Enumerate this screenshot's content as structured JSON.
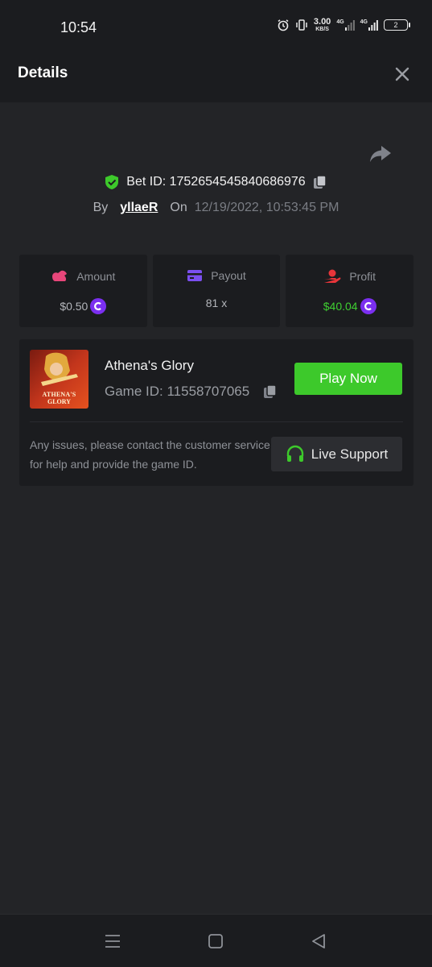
{
  "status_bar": {
    "time": "10:54",
    "network_speed": "3.00",
    "network_speed_unit": "KB/S",
    "network_1": "4G",
    "network_2": "4G",
    "battery": "2",
    "icons": [
      "alarm-icon",
      "vibrate-icon",
      "signal-icon",
      "signal-icon",
      "battery-icon"
    ]
  },
  "header": {
    "title": "Details",
    "close_icon": "close-icon"
  },
  "bet": {
    "share_icon": "share-icon",
    "verified_icon": "shield-check-icon",
    "bet_id_text": "Bet ID: 1752654545840686976",
    "copy_icon": "copy-icon",
    "by_label": "By",
    "username": "yllaeR",
    "on_label": "On",
    "date": "12/19/2022, 10:53:45 PM"
  },
  "stats": [
    {
      "label": "Amount",
      "value": "$0.50",
      "icon": "coins-icon",
      "icon_color": "#e8467a",
      "value_color": "#b3b5ba",
      "currency_icon": "coin-c-icon"
    },
    {
      "label": "Payout",
      "value": "81 x",
      "icon": "card-icon",
      "icon_color": "#7b4ff0",
      "value_color": "#b3b5ba"
    },
    {
      "label": "Profit",
      "value": "$40.04",
      "icon": "hand-coin-icon",
      "icon_color": "#e8353a",
      "value_color": "#3fcf31",
      "currency_icon": "coin-c-icon"
    }
  ],
  "game": {
    "thumbnail_text": "ATHENA'S GLORY",
    "name": "Athena's Glory",
    "game_id_text": "Game ID: 11558707065",
    "copy_icon": "copy-icon",
    "play_button": "Play Now",
    "issue_text": "Any issues, please contact the customer service for help and provide the game ID.",
    "support_button": "Live Support",
    "support_icon": "headset-icon"
  },
  "colors": {
    "background": "#232427",
    "panel": "#1b1c1f",
    "accent_green": "#3dc92b",
    "coin_purple": "#7b2ff0"
  },
  "nav_bar": [
    "menu-icon",
    "home-icon",
    "back-icon"
  ]
}
